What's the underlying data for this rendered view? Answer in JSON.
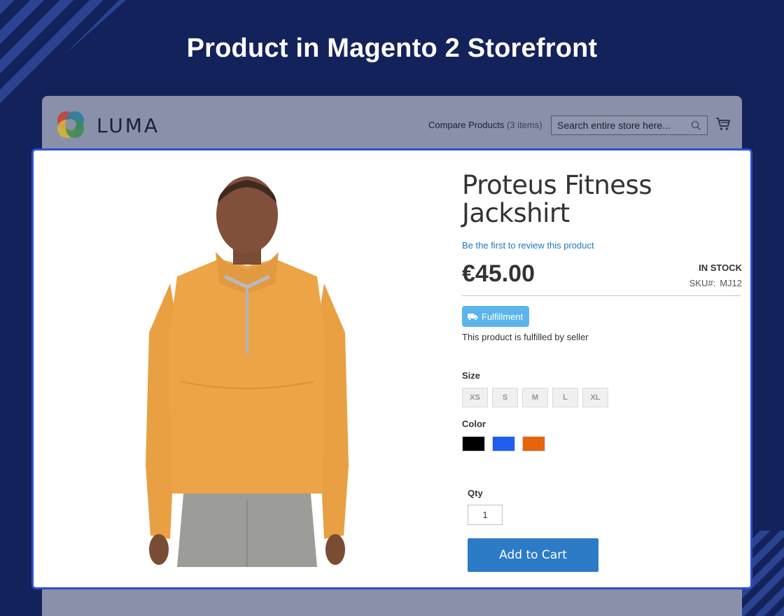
{
  "headline": "Product in Magento 2 Storefront",
  "store": {
    "logo_text": "LUMA",
    "compare_label": "Compare Products",
    "compare_count": "(3 items)",
    "search_placeholder": "Search entire store here..."
  },
  "product": {
    "title": "Proteus Fitness Jackshirt",
    "review_link": "Be the first to review this product",
    "price": "€45.00",
    "stock_status": "In stock",
    "sku_label": "SKU#:",
    "sku_value": "MJ12",
    "badge_label": "Fulfillment",
    "fulfillment_note": "This product is fulfilled by seller",
    "size_label": "Size",
    "sizes": [
      "XS",
      "S",
      "M",
      "L",
      "XL"
    ],
    "color_label": "Color",
    "colors": [
      "#000000",
      "#1f5ff0",
      "#e5640c"
    ],
    "qty_label": "Qty",
    "qty_value": "1",
    "add_to_cart_label": "Add to Cart"
  },
  "icons": {
    "search": "search-icon",
    "cart": "cart-icon",
    "badge": "truck-icon"
  },
  "theme": {
    "page_background": "#13225a",
    "panel_border": "#2f4fcf",
    "link": "#1979c3",
    "button": "#2b7bc7",
    "badge": "#5bb5ec"
  }
}
